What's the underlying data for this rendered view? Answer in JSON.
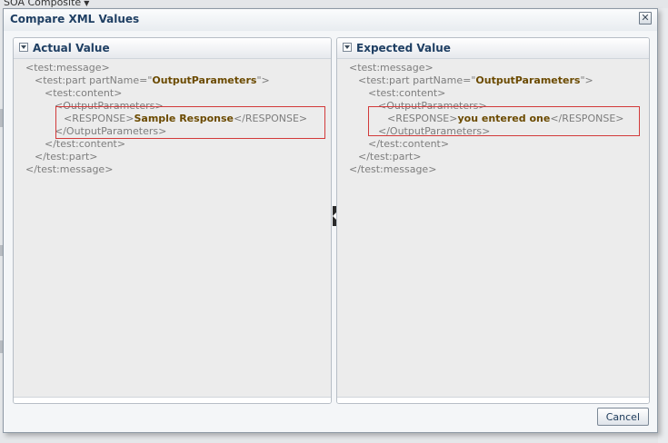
{
  "background": {
    "breadcrumb": "SOA Composite"
  },
  "dialog": {
    "title": "Compare XML Values",
    "close_glyph": "✕",
    "cancel_label": "Cancel"
  },
  "actual": {
    "header": "Actual Value",
    "lines": {
      "l1": "<test:message>",
      "l2_pre": "<test:part  partName=\"",
      "l2_val": "OutputParameters",
      "l2_post": "\">",
      "l3": "<test:content>",
      "l4": "<OutputParameters>",
      "l5_pre": "<RESPONSE>",
      "l5_val": "Sample Response",
      "l5_post": "</RESPONSE>",
      "l6": "</OutputParameters>",
      "l7": "</test:content>",
      "l8": "</test:part>",
      "l9": "</test:message>"
    }
  },
  "expected": {
    "header": "Expected Value",
    "lines": {
      "l1": "<test:message>",
      "l2_pre": "<test:part  partName=\"",
      "l2_val": "OutputParameters",
      "l2_post": "\">",
      "l3": "<test:content>",
      "l4": "<OutputParameters>",
      "l5_pre": "<RESPONSE>",
      "l5_val": "you entered one",
      "l5_post": "</RESPONSE>",
      "l6": "</OutputParameters>",
      "l7": "</test:content>",
      "l8": "</test:part>",
      "l9": "</test:message>"
    }
  },
  "colors": {
    "title_blue": "#1f3f63",
    "value_brown": "#6b4a00",
    "highlight_red": "#d23a3a"
  }
}
